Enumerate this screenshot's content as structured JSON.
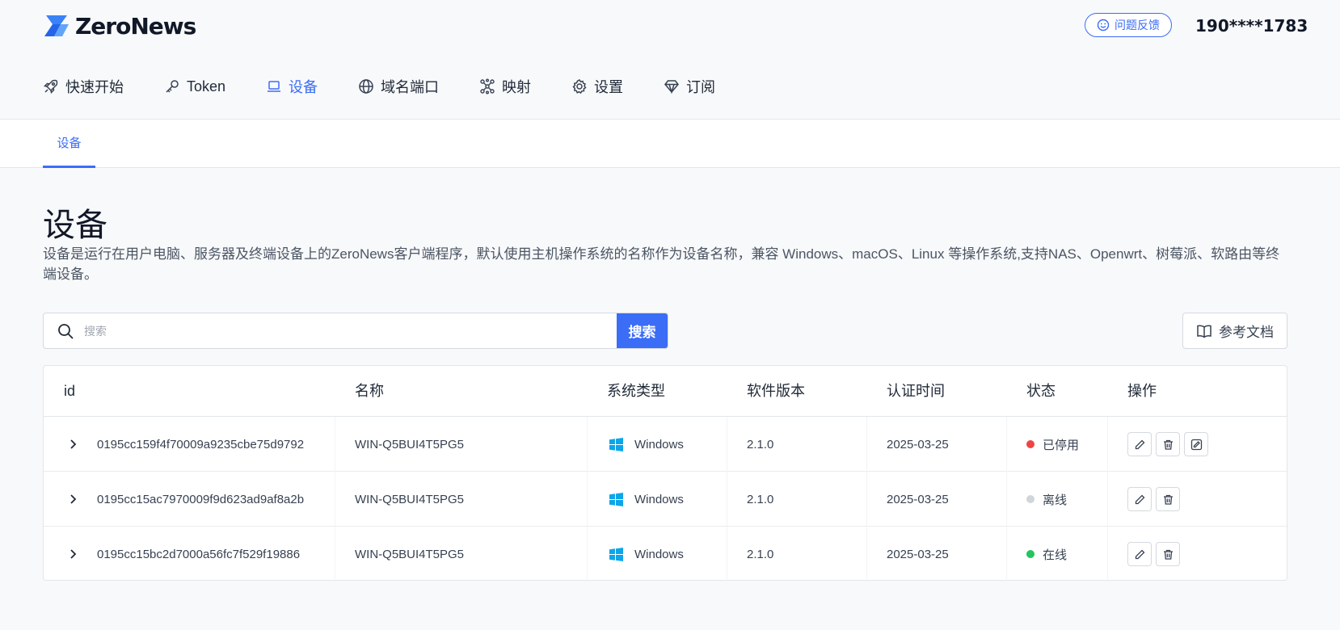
{
  "brand": {
    "name": "ZeroNews",
    "accent": "#3b6df6",
    "logo_icon": "zeronews-lightning-icon"
  },
  "header": {
    "feedback_label": "问题反馈",
    "feedback_icon": "smiley-icon",
    "user_phone": "190****1783"
  },
  "nav": {
    "items": [
      {
        "label": "快速开始",
        "icon": "rocket-icon",
        "active": false
      },
      {
        "label": "Token",
        "icon": "key-icon",
        "active": false
      },
      {
        "label": "设备",
        "icon": "laptop-icon",
        "active": true
      },
      {
        "label": "域名端口",
        "icon": "globe-icon",
        "active": false
      },
      {
        "label": "映射",
        "icon": "network-icon",
        "active": false
      },
      {
        "label": "设置",
        "icon": "gear-icon",
        "active": false
      },
      {
        "label": "订阅",
        "icon": "diamond-icon",
        "active": false
      }
    ]
  },
  "subtabs": [
    {
      "label": "设备",
      "active": true
    }
  ],
  "page": {
    "title": "设备",
    "description": "设备是运行在用户电脑、服务器及终端设备上的ZeroNews客户端程序，默认使用主机操作系统的名称作为设备名称，兼容 Windows、macOS、Linux 等操作系统,支持NAS、Openwrt、树莓派、软路由等终端设备。"
  },
  "search": {
    "placeholder": "搜索",
    "value": "",
    "button_label": "搜索"
  },
  "docs_button": {
    "label": "参考文档",
    "icon": "book-icon"
  },
  "table": {
    "headers": {
      "id": "id",
      "name": "名称",
      "os": "系统类型",
      "version": "软件版本",
      "auth_time": "认证时间",
      "status": "状态",
      "actions": "操作"
    },
    "rows": [
      {
        "id": "0195cc159f4f70009a9235cbe75d9792",
        "name": "WIN-Q5BUI4T5PG5",
        "os": "Windows",
        "version": "2.1.0",
        "auth_time": "2025-03-25",
        "status": "已停用",
        "status_color": "#ef4444",
        "actions": [
          "edit-icon",
          "trash-icon",
          "enable-icon"
        ]
      },
      {
        "id": "0195cc15ac7970009f9d623ad9af8a2b",
        "name": "WIN-Q5BUI4T5PG5",
        "os": "Windows",
        "version": "2.1.0",
        "auth_time": "2025-03-25",
        "status": "离线",
        "status_color": "#d1d5db",
        "actions": [
          "edit-icon",
          "trash-icon"
        ]
      },
      {
        "id": "0195cc15bc2d7000a56fc7f529f19886",
        "name": "WIN-Q5BUI4T5PG5",
        "os": "Windows",
        "version": "2.1.0",
        "auth_time": "2025-03-25",
        "status": "在线",
        "status_color": "#22c55e",
        "actions": [
          "edit-icon",
          "trash-icon"
        ]
      }
    ]
  }
}
